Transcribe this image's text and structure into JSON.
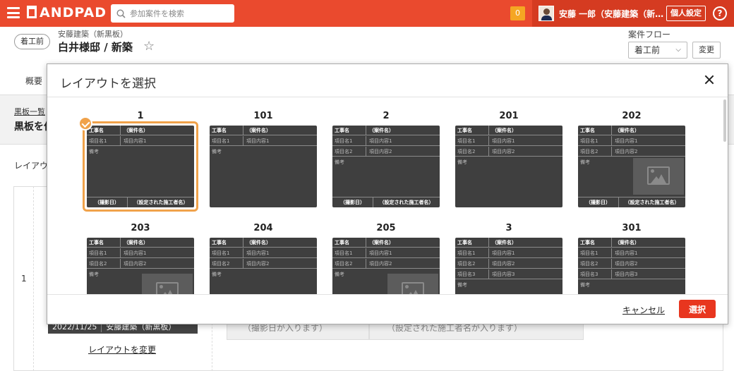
{
  "topbar": {
    "logo": "ANDPAD",
    "search_placeholder": "参加案件を検索",
    "notification_count": "0",
    "username": "安藤 一郎（安藤建築（新…",
    "personal_settings": "個人設定",
    "help": "?"
  },
  "project": {
    "status": "着工前",
    "company": "安藤建築（新黒板）",
    "title": "白井様邸 / 新築",
    "flow_label": "案件フロー",
    "flow_value": "着工前",
    "flow_change": "変更",
    "tab_overview": "概要"
  },
  "page": {
    "breadcrumb": "黒板一覧",
    "title": "黒板を作",
    "layout_label": "レイアウ",
    "row_number": "1",
    "board_date": "2022/11/25",
    "board_company": "安藤建築（新黒板）",
    "change_layout": "レイアウトを変更",
    "cell_date": "（撮影日が入ります）",
    "cell_builder": "（設定された施工者名が入ります）"
  },
  "modal": {
    "title": "レイアウトを選択",
    "cancel": "キャンセル",
    "select": "選択",
    "selected_index": 0,
    "labels": {
      "construction": "工事名",
      "case_name": "（案件名）",
      "item_name_1": "項目名1",
      "item_content_1": "項目内容1",
      "item_name_2": "項目名2",
      "item_content_2": "項目内容2",
      "item_name_3": "項目名3",
      "item_content_3": "項目内容3",
      "remarks": "備考",
      "shoot_date": "（撮影日）",
      "builder": "（設定された施工者名）"
    },
    "layouts": [
      {
        "name": "1",
        "items": 1,
        "footer": true,
        "photo": false
      },
      {
        "name": "101",
        "items": 1,
        "footer": false,
        "photo": false
      },
      {
        "name": "2",
        "items": 2,
        "footer": true,
        "photo": false
      },
      {
        "name": "201",
        "items": 2,
        "footer": false,
        "photo": false
      },
      {
        "name": "202",
        "items": 2,
        "footer": true,
        "photo": true
      },
      {
        "name": "203",
        "items": 2,
        "footer": false,
        "photo": true
      },
      {
        "name": "204",
        "items": 2,
        "footer": false,
        "photo": false
      },
      {
        "name": "205",
        "items": 2,
        "footer": false,
        "photo": true
      },
      {
        "name": "3",
        "items": 3,
        "footer": false,
        "photo": false
      },
      {
        "name": "301",
        "items": 3,
        "footer": false,
        "photo": false
      }
    ]
  },
  "colors": {
    "brand": "#ea4a2e",
    "brand_dark": "#d53b21",
    "select_button": "#e8361f",
    "selected_ring": "#f0a24a",
    "board": "#3f3f3f"
  },
  "icons": {
    "menu": "hamburger-icon",
    "search": "search-icon",
    "help": "help-icon",
    "favorite": "star-icon",
    "close": "close-icon",
    "check": "check-icon",
    "photo": "image-placeholder-icon"
  }
}
